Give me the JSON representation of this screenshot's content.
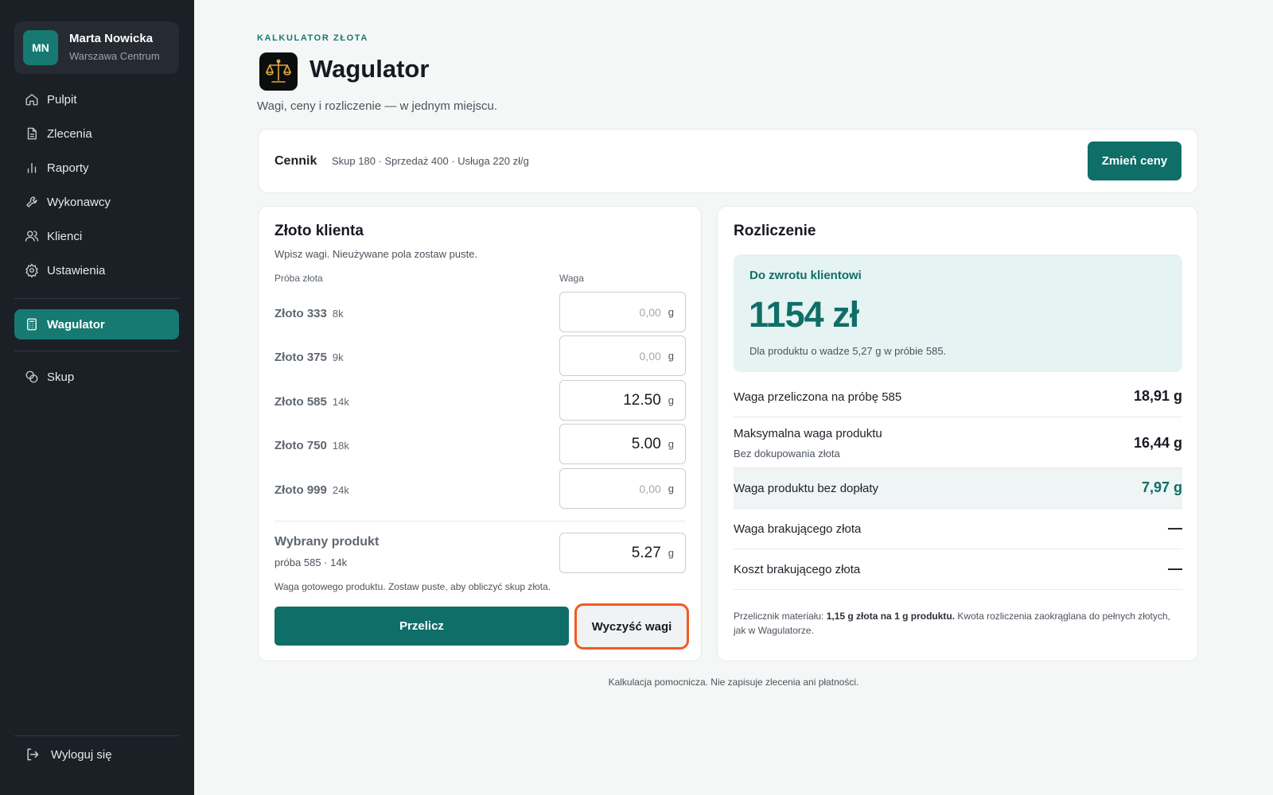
{
  "user": {
    "initials": "MN",
    "name": "Marta Nowicka",
    "location": "Warszawa Centrum"
  },
  "nav": {
    "items": [
      {
        "label": "Pulpit",
        "icon": "home-icon"
      },
      {
        "label": "Zlecenia",
        "icon": "document-icon"
      },
      {
        "label": "Raporty",
        "icon": "bar-chart-icon"
      },
      {
        "label": "Wykonawcy",
        "icon": "wrench-icon"
      },
      {
        "label": "Klienci",
        "icon": "users-icon"
      },
      {
        "label": "Ustawienia",
        "icon": "gear-icon"
      }
    ],
    "active": {
      "label": "Wagulator",
      "icon": "calculator-icon"
    },
    "extra": {
      "label": "Skup",
      "icon": "coins-icon"
    },
    "logout": "Wyloguj się"
  },
  "header": {
    "eyebrow": "KALKULATOR ZŁOTA",
    "title": "Wagulator",
    "subtitle": "Wagi, ceny i rozliczenie — w jednym miejscu.",
    "logo_icon": "scales-icon"
  },
  "pricing": {
    "label": "Cennik",
    "text": "Skup 180 · Sprzedaż 400 · Usługa 220 zł/g",
    "button": "Zmień ceny"
  },
  "client_gold": {
    "title": "Złoto klienta",
    "hint": "Wpisz wagi. Nieużywane pola zostaw puste.",
    "col_sample": "Próba złota",
    "col_weight": "Waga",
    "unit": "g",
    "rows": [
      {
        "label": "Złoto 333",
        "karat": "8k",
        "value": "",
        "placeholder": "0,00"
      },
      {
        "label": "Złoto 375",
        "karat": "9k",
        "value": "",
        "placeholder": "0,00"
      },
      {
        "label": "Złoto 585",
        "karat": "14k",
        "value": "12.50",
        "placeholder": "0,00"
      },
      {
        "label": "Złoto 750",
        "karat": "18k",
        "value": "5.00",
        "placeholder": "0,00"
      },
      {
        "label": "Złoto 999",
        "karat": "24k",
        "value": "",
        "placeholder": "0,00"
      }
    ],
    "product": {
      "title": "Wybrany produkt",
      "sub": "próba 585 · 14k",
      "value": "5.27",
      "note": "Waga gotowego produktu. Zostaw puste, aby obliczyć skup złota."
    },
    "btn_calc": "Przelicz",
    "btn_clear": "Wyczyść wagi"
  },
  "settlement": {
    "title": "Rozliczenie",
    "refund_label": "Do zwrotu klientowi",
    "refund_amount": "1154 zł",
    "refund_note": "Dla produktu o wadze 5,27 g w próbie 585.",
    "rows": [
      {
        "label": "Waga przeliczona na próbę 585",
        "value": "18,91 g"
      },
      {
        "label": "Maksymalna waga produktu",
        "sublabel": "Bez dokupowania złota",
        "value": "16,44 g"
      },
      {
        "label": "Waga produktu bez dopłaty",
        "value": "7,97 g"
      },
      {
        "label": "Waga brakującego złota",
        "value": "—"
      },
      {
        "label": "Koszt brakującego złota",
        "value": "—"
      }
    ],
    "footnote_pre": "Przelicznik materiału: ",
    "footnote_bold": "1,15 g złota na 1 g produktu.",
    "footnote_post": " Kwota rozliczenia zaokrąglana do pełnych złotych, jak w Wagulatorze."
  },
  "bottom_note": "Kalkulacja pomocnicza. Nie zapisuje zlecenia ani płatności.",
  "colors": {
    "accent": "#0f6e68",
    "sidebar": "#1b1f26",
    "highlight_border": "#f05a22"
  }
}
